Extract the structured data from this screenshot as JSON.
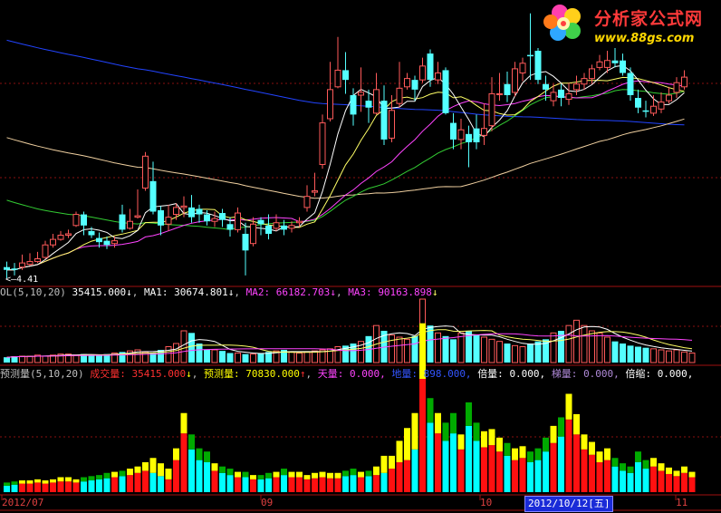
{
  "colors": {
    "up": "#ff5a5a",
    "down": "#54ffff",
    "ma5": "#ffffff",
    "ma10": "#ffff66",
    "ma20": "#ff44ff",
    "ma30": "#33cc33",
    "ma60": "#f0d0a0",
    "ma120": "#2244ff",
    "vol_red": "#ff1010",
    "vol_yellow": "#ffff00",
    "vol_cyan": "#00ffff",
    "vol_green": "#00aa00"
  },
  "logo": {
    "title": "分析家公式网",
    "url": "www.88gs.com"
  },
  "price_panel": {
    "low_marker": "4.41"
  },
  "vol_legend": {
    "title": "OL(5,10,20)",
    "value": "35415.000",
    "value_arrow": "↓",
    "ma1_label": "MA1:",
    "ma1_value": "30674.801",
    "ma1_arrow": "↓",
    "ma2_label": "MA2:",
    "ma2_value": "66182.703",
    "ma2_arrow": "↓",
    "ma3_label": "MA3:",
    "ma3_value": "90163.898",
    "ma3_arrow": "↓"
  },
  "ind_legend": {
    "title": "预测量(5,10,20)",
    "chengjiao_label": "成交量:",
    "chengjiao_value": "35415.000",
    "chengjiao_arrow": "↓",
    "yuce_label": "预测量:",
    "yuce_value": "70830.000",
    "yuce_arrow": "↑",
    "tian_label": "天量:",
    "tian_value": "0.000,",
    "di_label": "地量:",
    "di_value": "898.000,",
    "bei_label": "倍量:",
    "bei_value": "0.000,",
    "ti_label": "梯量:",
    "ti_value": "0.000,",
    "suo_label": "倍缩:",
    "suo_value": "0.000,"
  },
  "x_axis": {
    "labels": [
      "2012/07",
      "09",
      "10",
      "11"
    ],
    "selected_date": "2012/10/12[五]"
  },
  "chart_data": [
    {
      "type": "candlestick",
      "title": "",
      "note": "price values in the chart's vertical units (scale not printed); one low labeled 4.41",
      "candles": [
        [
          3.0,
          2.8,
          3.4,
          2.2
        ],
        [
          2.9,
          2.8,
          3.3,
          2.4
        ],
        [
          3.0,
          3.3,
          3.9,
          2.8
        ],
        [
          3.2,
          3.4,
          4.0,
          3.1
        ],
        [
          3.4,
          3.6,
          4.1,
          3.3
        ],
        [
          3.7,
          4.6,
          4.9,
          3.6
        ],
        [
          4.6,
          5.0,
          5.4,
          4.4
        ],
        [
          5.0,
          5.3,
          5.6,
          4.9
        ],
        [
          5.3,
          5.4,
          5.7,
          5.1
        ],
        [
          6.0,
          6.8,
          7.0,
          5.9
        ],
        [
          6.8,
          6.0,
          7.0,
          5.3
        ],
        [
          5.6,
          5.3,
          5.9,
          5.1
        ],
        [
          5.1,
          4.8,
          5.5,
          4.4
        ],
        [
          4.9,
          4.6,
          5.2,
          4.3
        ],
        [
          4.7,
          4.9,
          5.2,
          4.4
        ],
        [
          6.8,
          5.7,
          7.5,
          5.5
        ],
        [
          5.8,
          6.3,
          7.2,
          5.7
        ],
        [
          6.6,
          6.7,
          8.6,
          6.5
        ],
        [
          8.7,
          11.0,
          11.3,
          8.5
        ],
        [
          9.2,
          7.0,
          10.6,
          6.8
        ],
        [
          7.1,
          6.0,
          7.4,
          5.3
        ],
        [
          6.1,
          6.6,
          7.5,
          5.6
        ],
        [
          6.8,
          7.3,
          7.6,
          6.4
        ],
        [
          7.3,
          7.4,
          8.1,
          6.6
        ],
        [
          7.3,
          6.6,
          8.2,
          6.2
        ],
        [
          7.2,
          6.8,
          7.5,
          6.2
        ],
        [
          6.8,
          6.3,
          7.1,
          6.0
        ],
        [
          6.3,
          6.5,
          7.0,
          5.9
        ],
        [
          6.9,
          6.4,
          7.2,
          5.9
        ],
        [
          6.1,
          5.7,
          6.6,
          5.2
        ],
        [
          5.7,
          6.9,
          7.3,
          5.5
        ],
        [
          5.4,
          4.2,
          6.2,
          2.4
        ],
        [
          4.7,
          6.1,
          6.6,
          4.5
        ],
        [
          6.4,
          6.1,
          6.6,
          5.3
        ],
        [
          6.0,
          5.4,
          6.8,
          5.0
        ],
        [
          5.8,
          6.2,
          6.8,
          5.6
        ],
        [
          6.0,
          5.7,
          6.4,
          5.3
        ],
        [
          5.8,
          6.0,
          6.3,
          5.5
        ],
        [
          6.2,
          6.3,
          6.6,
          5.9
        ],
        [
          7.3,
          8.1,
          8.9,
          7.0
        ],
        [
          8.4,
          8.5,
          9.8,
          8.1
        ],
        [
          10.4,
          13.4,
          14.0,
          10.1
        ],
        [
          13.7,
          15.8,
          17.8,
          13.5
        ],
        [
          16.0,
          17.2,
          19.6,
          15.9
        ],
        [
          17.2,
          16.5,
          18.5,
          15.5
        ],
        [
          15.4,
          14.0,
          15.9,
          13.2
        ],
        [
          15.4,
          15.6,
          17.4,
          14.2
        ],
        [
          15.0,
          14.5,
          15.8,
          13.4
        ],
        [
          14.1,
          15.8,
          17.0,
          14.0
        ],
        [
          15.0,
          12.2,
          16.1,
          11.8
        ],
        [
          12.3,
          14.3,
          15.4,
          12.0
        ],
        [
          14.8,
          15.9,
          17.8,
          14.5
        ],
        [
          16.0,
          16.6,
          17.0,
          15.8
        ],
        [
          16.5,
          15.8,
          16.8,
          15.0
        ],
        [
          16.5,
          17.5,
          18.1,
          16.3
        ],
        [
          18.4,
          16.5,
          18.7,
          16.0
        ],
        [
          16.5,
          17.0,
          17.8,
          16.2
        ],
        [
          17.2,
          14.1,
          17.4,
          14.0
        ],
        [
          13.4,
          12.2,
          14.1,
          11.5
        ],
        [
          12.2,
          12.9,
          13.7,
          11.5
        ],
        [
          12.6,
          12.0,
          13.2,
          10.2
        ],
        [
          13.0,
          12.0,
          14.0,
          11.5
        ],
        [
          12.5,
          13.0,
          14.8,
          11.8
        ],
        [
          13.2,
          15.5,
          16.7,
          12.8
        ],
        [
          15.5,
          15.5,
          17.0,
          15.0
        ],
        [
          16.2,
          15.4,
          17.1,
          14.9
        ],
        [
          15.6,
          17.3,
          17.8,
          15.3
        ],
        [
          17.0,
          17.7,
          18.1,
          16.4
        ],
        [
          18.3,
          18.2,
          21.3,
          16.5
        ],
        [
          18.6,
          16.5,
          18.8,
          16.2
        ],
        [
          16.2,
          15.8,
          16.8,
          15.0
        ],
        [
          15.0,
          15.6,
          16.2,
          14.6
        ],
        [
          15.8,
          15.2,
          16.2,
          14.6
        ],
        [
          15.1,
          15.5,
          16.3,
          14.7
        ],
        [
          15.8,
          16.2,
          16.8,
          15.4
        ],
        [
          16.2,
          16.6,
          17.0,
          15.8
        ],
        [
          16.6,
          17.3,
          17.6,
          16.2
        ],
        [
          17.4,
          17.8,
          18.3,
          17.2
        ],
        [
          17.4,
          17.9,
          18.6,
          17.0
        ],
        [
          17.9,
          17.7,
          18.8,
          17.4
        ],
        [
          17.9,
          17.0,
          18.4,
          16.8
        ],
        [
          17.0,
          15.4,
          17.4,
          15.0
        ],
        [
          15.2,
          14.5,
          15.8,
          14.1
        ],
        [
          14.3,
          14.2,
          15.0,
          13.8
        ],
        [
          14.1,
          14.6,
          15.4,
          13.9
        ],
        [
          14.4,
          14.9,
          15.6,
          14.1
        ],
        [
          15.0,
          15.4,
          16.0,
          14.8
        ],
        [
          15.6,
          16.3,
          16.7,
          15.2
        ],
        [
          16.0,
          16.7,
          17.2,
          15.8
        ]
      ]
    },
    {
      "type": "bar",
      "title": "VOL",
      "values": [
        5,
        6,
        6,
        6,
        7,
        6,
        7,
        8,
        8,
        7,
        8,
        7,
        7,
        8,
        9,
        10,
        11,
        12,
        10,
        9,
        12,
        15,
        18,
        30,
        28,
        18,
        12,
        12,
        11,
        9,
        9,
        8,
        8,
        9,
        10,
        11,
        12,
        10,
        9,
        10,
        11,
        12,
        13,
        15,
        16,
        18,
        20,
        25,
        35,
        30,
        26,
        24,
        22,
        25,
        60,
        35,
        28,
        25,
        22,
        28,
        30,
        26,
        24,
        22,
        20,
        18,
        16,
        15,
        18,
        20,
        22,
        28,
        30,
        35,
        40,
        35,
        30,
        28,
        24,
        20,
        18,
        16,
        15,
        14,
        13,
        12,
        11,
        12,
        10,
        9
      ]
    },
    {
      "type": "bar",
      "title": "预测量",
      "values": [
        6,
        7,
        8,
        8,
        9,
        8,
        9,
        10,
        10,
        9,
        10,
        11,
        12,
        13,
        14,
        15,
        16,
        18,
        20,
        18,
        15,
        12,
        30,
        55,
        40,
        30,
        28,
        20,
        18,
        16,
        14,
        14,
        12,
        12,
        13,
        14,
        16,
        14,
        14,
        12,
        13,
        14,
        13,
        13,
        15,
        16,
        14,
        15,
        16,
        18,
        22,
        28,
        30,
        40,
        106,
        65,
        55,
        48,
        55,
        40,
        62,
        48,
        42,
        44,
        38,
        34,
        30,
        32,
        28,
        30,
        38,
        46,
        52,
        68,
        54,
        40,
        35,
        28,
        30,
        24,
        20,
        18,
        28,
        22,
        24,
        20,
        17,
        15,
        18,
        14
      ],
      "stacked_top": [
        0,
        0,
        0,
        0,
        0,
        0,
        0,
        0,
        0,
        0,
        0,
        0,
        0,
        0,
        0,
        0,
        0,
        0,
        8,
        14,
        12,
        10,
        0,
        0,
        0,
        0,
        0,
        0,
        0,
        0,
        0,
        0,
        0,
        0,
        0,
        0,
        0,
        0,
        0,
        0,
        0,
        0,
        0,
        0,
        0,
        0,
        0,
        0,
        8,
        16,
        12,
        20,
        30,
        34,
        52,
        0,
        0,
        0,
        0,
        0,
        0,
        0,
        0,
        0,
        0,
        0,
        0,
        0,
        0,
        0,
        0,
        0,
        0,
        0,
        0,
        0,
        0,
        0,
        0,
        0,
        0,
        0,
        0,
        0,
        0,
        0,
        0,
        0,
        0,
        0
      ]
    }
  ]
}
